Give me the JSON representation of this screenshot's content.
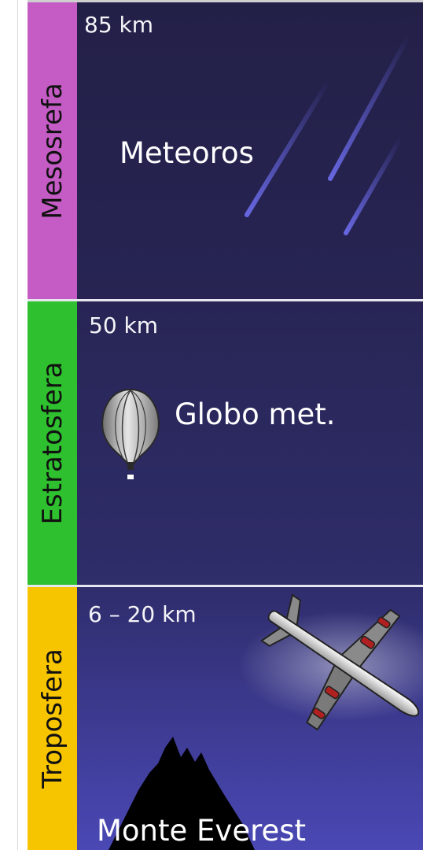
{
  "layers": [
    {
      "name": "Mesosrefa",
      "altitude": "85 km",
      "feature": "Meteoros",
      "band_color": "#c55cc5",
      "icon": "meteor-icon"
    },
    {
      "name": "Estratosfera",
      "altitude": "50 km",
      "feature": "Globo met.",
      "band_color": "#2ec02e",
      "icon": "weather-balloon-icon"
    },
    {
      "name": "Troposfera",
      "altitude": "6 – 20 km",
      "feature": "Monte Everest",
      "band_color": "#f7c400",
      "icon": "airplane-icon"
    }
  ],
  "colors": {
    "sky_top": "#232048",
    "sky_bottom": "#4a48b4",
    "separator": "#e6e6ee"
  }
}
